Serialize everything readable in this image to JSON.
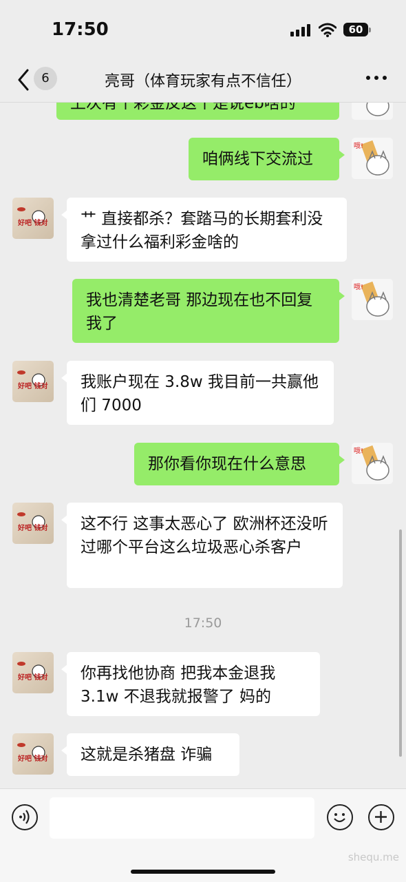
{
  "status_bar": {
    "time": "17:50",
    "battery": "60"
  },
  "header": {
    "unread_count": "6",
    "title": "亮哥（体育玩家有点不信任）"
  },
  "messages": [
    {
      "side": "me",
      "text": "上次有个彩金反这个是说eb啥的"
    },
    {
      "side": "me",
      "text": "咱俩线下交流过"
    },
    {
      "side": "them",
      "text": "艹 直接都杀？套踏马的长期套利没拿过什么福利彩金啥的"
    },
    {
      "side": "me",
      "text": "我也清楚老哥  那边现在也不回复我了"
    },
    {
      "side": "them",
      "text": "我账户现在 3.8w 我目前一共赢他们 7000"
    },
    {
      "side": "me",
      "text": "那你看你现在什么意思"
    },
    {
      "side": "them",
      "text": "这不行 这事太恶心了  欧洲杯还没听过哪个平台这么垃圾恶心杀客户"
    },
    {
      "side": "them",
      "text": "你再找他协商  把我本金退我 3.1w 不退我就报警了 妈的"
    },
    {
      "side": "them",
      "text": "这就是杀猪盘 诈骗"
    }
  ],
  "timestamp_divider": "17:50",
  "avatar_labels": {
    "them": "好吧 钱对",
    "me": "哦!"
  },
  "colors": {
    "my_bubble": "#95ec69",
    "their_bubble": "#ffffff",
    "background": "#ededed"
  },
  "icons": {
    "back": "chevron-left-icon",
    "more": "more-dots-icon",
    "voice": "voice-icon",
    "emoji": "emoji-icon",
    "add": "plus-icon"
  },
  "watermark": "shequ.me"
}
